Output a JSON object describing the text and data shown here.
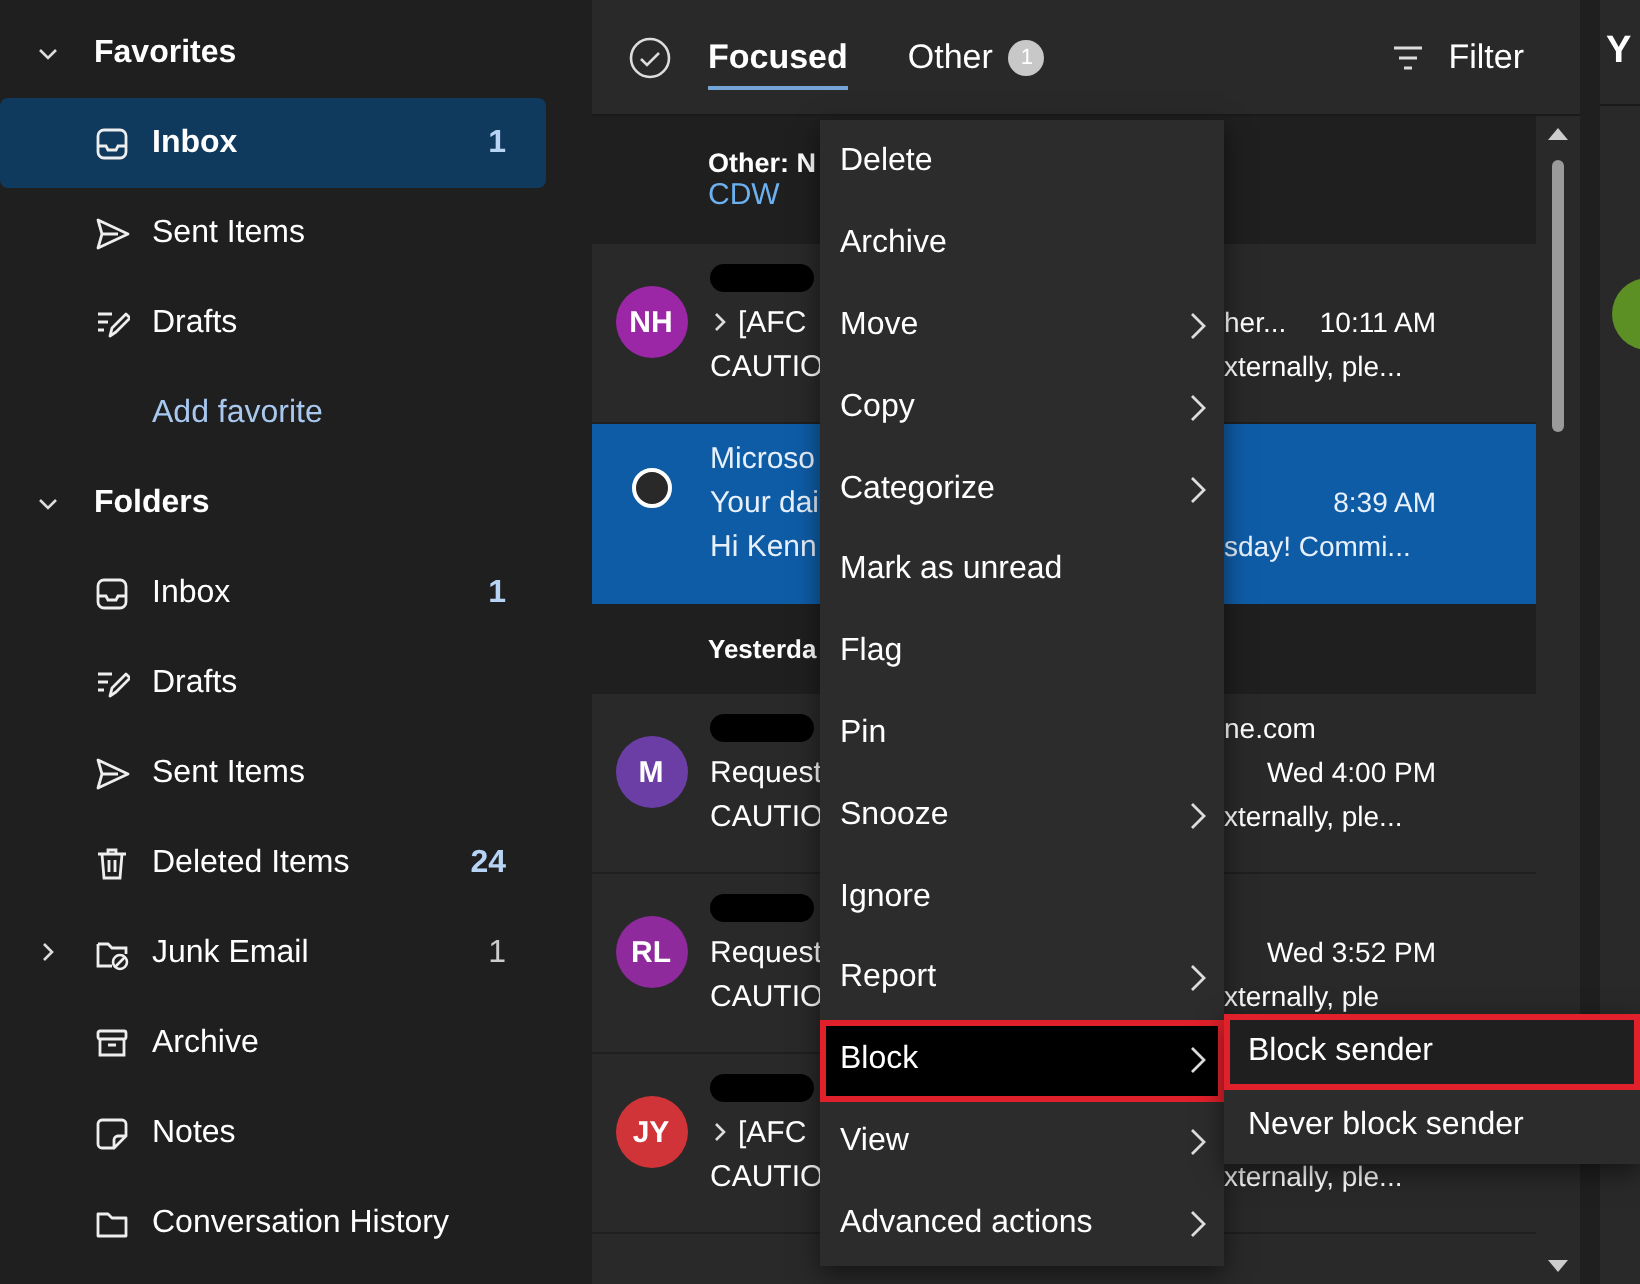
{
  "sidebar": {
    "sections": [
      {
        "title": "Favorites",
        "expanded": true,
        "items": [
          {
            "kind": "inbox",
            "label": "Inbox",
            "count": "1",
            "unread": true,
            "selected": true,
            "expander": false
          },
          {
            "kind": "sent",
            "label": "Sent Items",
            "selected": false,
            "expander": false
          },
          {
            "kind": "drafts",
            "label": "Drafts",
            "selected": false,
            "expander": false
          },
          {
            "kind": "link",
            "label": "Add favorite",
            "selected": false,
            "expander": false
          }
        ]
      },
      {
        "title": "Folders",
        "expanded": true,
        "items": [
          {
            "kind": "inbox",
            "label": "Inbox",
            "count": "1",
            "unread": true,
            "selected": false,
            "expander": false
          },
          {
            "kind": "drafts",
            "label": "Drafts",
            "selected": false,
            "expander": false
          },
          {
            "kind": "sent",
            "label": "Sent Items",
            "selected": false,
            "expander": false
          },
          {
            "kind": "deleted",
            "label": "Deleted Items",
            "count": "24",
            "unread": true,
            "selected": false,
            "expander": false
          },
          {
            "kind": "junk",
            "label": "Junk Email",
            "count": "1",
            "unread": false,
            "selected": false,
            "expander": true
          },
          {
            "kind": "archive",
            "label": "Archive",
            "selected": false,
            "expander": false
          },
          {
            "kind": "notes",
            "label": "Notes",
            "selected": false,
            "expander": false
          },
          {
            "kind": "folder",
            "label": "Conversation History",
            "selected": false,
            "expander": false
          }
        ]
      }
    ]
  },
  "list": {
    "tabs": [
      {
        "label": "Focused",
        "selected": true
      },
      {
        "label": "Other",
        "badge": "1",
        "selected": false
      }
    ],
    "filter": "Filter",
    "rows": [
      {
        "kind": "banner",
        "lines": [
          "Other: N",
          "CDW"
        ]
      },
      {
        "kind": "message",
        "avatar": "NH",
        "color": "#9c27a6",
        "selected": false,
        "redacted": true,
        "subject": {
          "left": "[AFC",
          "chevron": true,
          "right": "her...",
          "time": "10:11 AM"
        },
        "preview": {
          "left": "CAUTIO",
          "right": "xternally, ple..."
        }
      },
      {
        "kind": "message",
        "selected": true,
        "redacted": false,
        "sender": {
          "left": "Microso"
        },
        "subject": {
          "left": "Your dai",
          "time": "8:39 AM"
        },
        "preview": {
          "left": "Hi Kenn",
          "right": "sday! Commi..."
        }
      },
      {
        "kind": "date",
        "lines": [
          "Yesterda"
        ]
      },
      {
        "kind": "message",
        "avatar": "M",
        "color": "#6b3ea6",
        "selected": false,
        "redacted": true,
        "sender": {
          "right": "ne.com"
        },
        "subject": {
          "left": "Request",
          "time": "Wed 4:00 PM"
        },
        "preview": {
          "left": "CAUTIO",
          "right": "xternally, ple..."
        }
      },
      {
        "kind": "message",
        "avatar": "RL",
        "color": "#8e2a9c",
        "selected": false,
        "redacted": true,
        "subject": {
          "left": "Request",
          "time": "Wed 3:52 PM"
        },
        "preview": {
          "left": "CAUTIO",
          "right": "xternally, ple"
        }
      },
      {
        "kind": "message",
        "avatar": "JY",
        "color": "#d13438",
        "selected": false,
        "redacted": true,
        "subject": {
          "left": "[AFC",
          "chevron": true
        },
        "preview": {
          "left": "CAUTIO",
          "right": "xternally, ple..."
        }
      }
    ]
  },
  "reading_pane": {
    "title": "Y"
  },
  "context_menu": {
    "items": [
      {
        "label": "Delete",
        "submenu": false,
        "highlighted": false
      },
      {
        "label": "Archive",
        "submenu": false,
        "highlighted": false
      },
      {
        "label": "Move",
        "submenu": true,
        "highlighted": false
      },
      {
        "label": "Copy",
        "submenu": true,
        "highlighted": false
      },
      {
        "label": "Categorize",
        "submenu": true,
        "highlighted": false
      },
      {
        "label": "Mark as unread",
        "submenu": false,
        "highlighted": false
      },
      {
        "label": "Flag",
        "submenu": false,
        "highlighted": false
      },
      {
        "label": "Pin",
        "submenu": false,
        "highlighted": false
      },
      {
        "label": "Snooze",
        "submenu": true,
        "highlighted": false
      },
      {
        "label": "Ignore",
        "submenu": false,
        "highlighted": false
      },
      {
        "label": "Report",
        "submenu": true,
        "highlighted": false
      },
      {
        "label": "Block",
        "submenu": true,
        "highlighted": true
      },
      {
        "label": "View",
        "submenu": true,
        "highlighted": false
      },
      {
        "label": "Advanced actions",
        "submenu": true,
        "highlighted": false
      }
    ]
  },
  "submenu": {
    "items": [
      {
        "label": "Block sender",
        "highlighted": true
      },
      {
        "label": "Never block sender",
        "highlighted": false
      }
    ]
  }
}
